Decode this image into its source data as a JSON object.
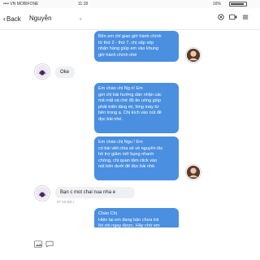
{
  "status": {
    "carrier": "•••• VN MOBIFONE ",
    "time": "11:18",
    "battery": "16%"
  },
  "header": {
    "back_label": "Back",
    "contact_name": "Nguyễn",
    "icons": [
      "call-icon",
      "video-icon",
      "menu-icon"
    ]
  },
  "messages": {
    "m1": {
      "lines": [
        "Bên em chỉ giao giờ hành chính",
        "từ thứ 2 - thứ 7, chị sắp xếp",
        "nhận hàng giúp em vào khung",
        "giờ hành chính nhé"
      ]
    },
    "r1": {
      "text": "Oke"
    },
    "m2": {
      "lines": [
        "Em chào chị Ng               n! Em",
        "gửi chị bài hướng dẫn nhận các",
        "mã mặt và chế độ ăn uống giúp",
        "phát triển tăng mị, lồng mày từ",
        "bên trong ạ. Chị kích vào nút để",
        "đọc bài nhé."
      ]
    },
    "m3": {
      "lines": [
        "Em chào chị Ngu               ! Em",
        "có bài viết chia sẻ về nguyên tắc",
        "hỗ trợ giảm mỡ bụng nhanh",
        "chóng, chị quan tâm click vào",
        "nút bên dưới để đọc bài nhé."
      ]
    },
    "r2": {
      "text": "Bạn c mot chai nua nha e",
      "time": "07:10 Đã t"
    },
    "m4": {
      "lines": [
        "Chào Chị",
        "Hiện tại em đang bận chưa trả",
        "lời chị ngay được. Hãy chờ em"
      ]
    }
  },
  "toolbar": {
    "icons": [
      "image-icon",
      "chat-icon"
    ]
  },
  "colors": {
    "bubble": "#4a8fe0",
    "received": "#eef0f3",
    "accent": "#3a7bd5"
  }
}
